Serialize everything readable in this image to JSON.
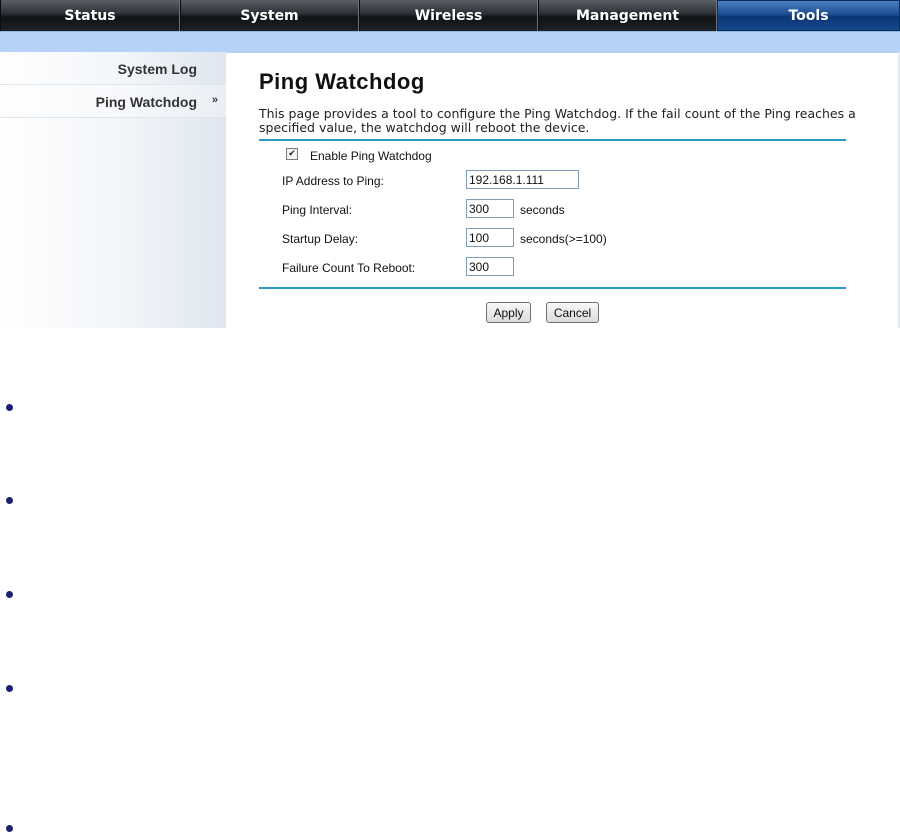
{
  "nav": {
    "tabs": [
      {
        "label": "Status"
      },
      {
        "label": "System"
      },
      {
        "label": "Wireless"
      },
      {
        "label": "Management"
      },
      {
        "label": "Tools",
        "active": true
      }
    ]
  },
  "sidebar": {
    "items": [
      {
        "label": "System Log"
      },
      {
        "label": "Ping Watchdog",
        "arrow": "»",
        "active": true
      }
    ]
  },
  "page": {
    "title": "Ping Watchdog",
    "description_line1": "This page provides a tool to configure the Ping Watchdog. If the fail count of the Ping reaches a",
    "description_line2": "specified value, the watchdog will reboot the device."
  },
  "form": {
    "enable": {
      "label": "Enable Ping Watchdog",
      "checked": true,
      "check_glyph": "✔"
    },
    "ip": {
      "label": "IP Address to Ping:",
      "value": "192.168.1.111"
    },
    "interval": {
      "label": "Ping Interval:",
      "value": "300",
      "unit": "seconds"
    },
    "startup": {
      "label": "Startup Delay:",
      "value": "100",
      "unit": "seconds(>=100)"
    },
    "failure": {
      "label": "Failure Count To Reboot:",
      "value": "300"
    }
  },
  "buttons": {
    "apply": "Apply",
    "cancel": "Cancel"
  },
  "colors": {
    "accent_rule": "#2a9bc7",
    "active_tab": "#1c4f92",
    "bullet": "#1a1f73"
  }
}
